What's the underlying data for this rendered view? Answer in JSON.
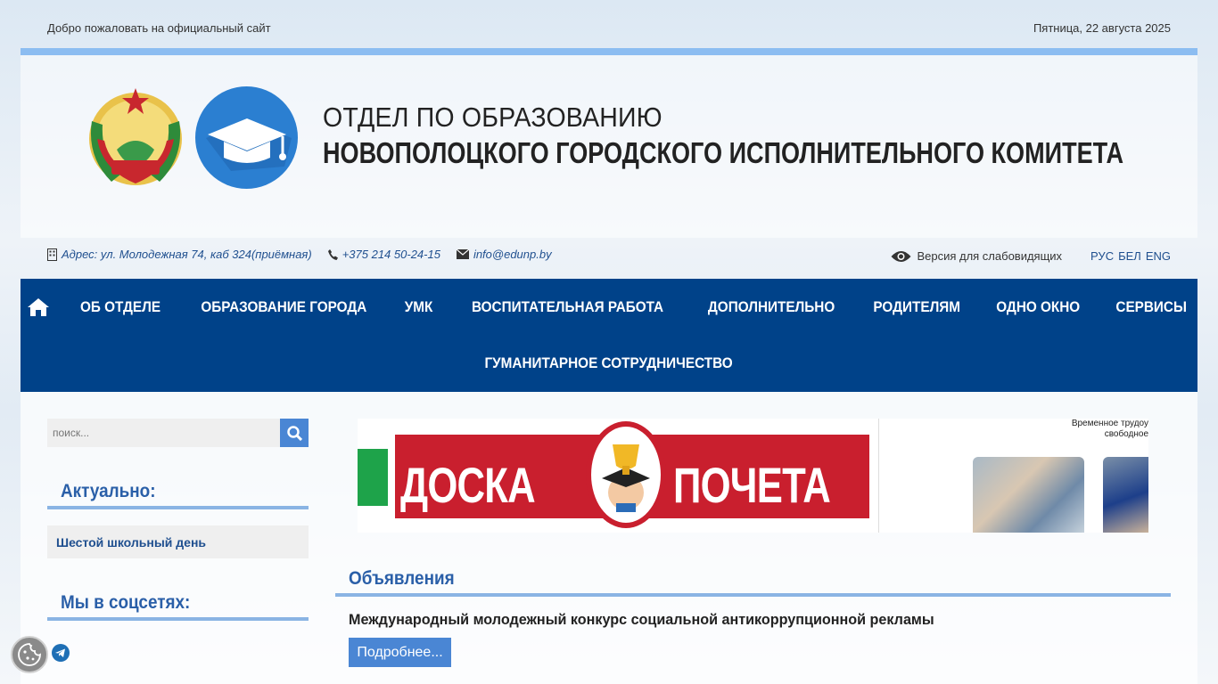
{
  "topbar": {
    "welcome": "Добро пожаловать на официальный сайт",
    "date": "Пятница, 22 августа 2025"
  },
  "header": {
    "title_line1": "ОТДЕЛ ПО ОБРАЗОВАНИЮ",
    "title_line2": "НОВОПОЛОЦКОГО ГОРОДСКОГО ИСПОЛНИТЕЛЬНОГО КОМИТЕТА",
    "emblem_icon": "belarus-emblem-icon",
    "logo_icon": "graduation-cap-icon"
  },
  "contacts": {
    "address": "Адрес: ул. Молодежная 74, каб 324(приёмная)",
    "phone": "+375 214 50-24-15",
    "email": "info@edunp.by"
  },
  "tools": {
    "vision_label": "Версия для слабовидящих",
    "lang_ru": "РУС",
    "lang_be": "БЕЛ",
    "lang_en": "ENG"
  },
  "nav": {
    "home_icon": "home-icon",
    "items": [
      {
        "label": "Об отделе"
      },
      {
        "label": "Образование города"
      },
      {
        "label": "УМК"
      },
      {
        "label": "Воспитательная работа"
      },
      {
        "label": "Дополнительно"
      },
      {
        "label": "Родителям"
      },
      {
        "label": "Одно окно"
      },
      {
        "label": "Сервисы"
      },
      {
        "label": "Гуманитарное сотрудничество"
      }
    ]
  },
  "sidebar": {
    "search_placeholder": "поиск...",
    "actual_title": "Актуально:",
    "actual_items": [
      {
        "label": "Шестой школьный день"
      }
    ],
    "social_title": "Мы в соцсетях:"
  },
  "banner": {
    "text_left": "ДОСКА",
    "text_right": "ПОЧЕТА",
    "note": "Временное трудоу свободное"
  },
  "announcements": {
    "title": "Объявления",
    "headline": "Международный молодежный конкурс социальной антикоррупционной рекламы",
    "more_label": "Подробнее..."
  },
  "colors": {
    "nav_bg": "#004289",
    "accent": "#4a86d4",
    "line": "#8cbdf1",
    "banner_red": "#c91f2e"
  }
}
